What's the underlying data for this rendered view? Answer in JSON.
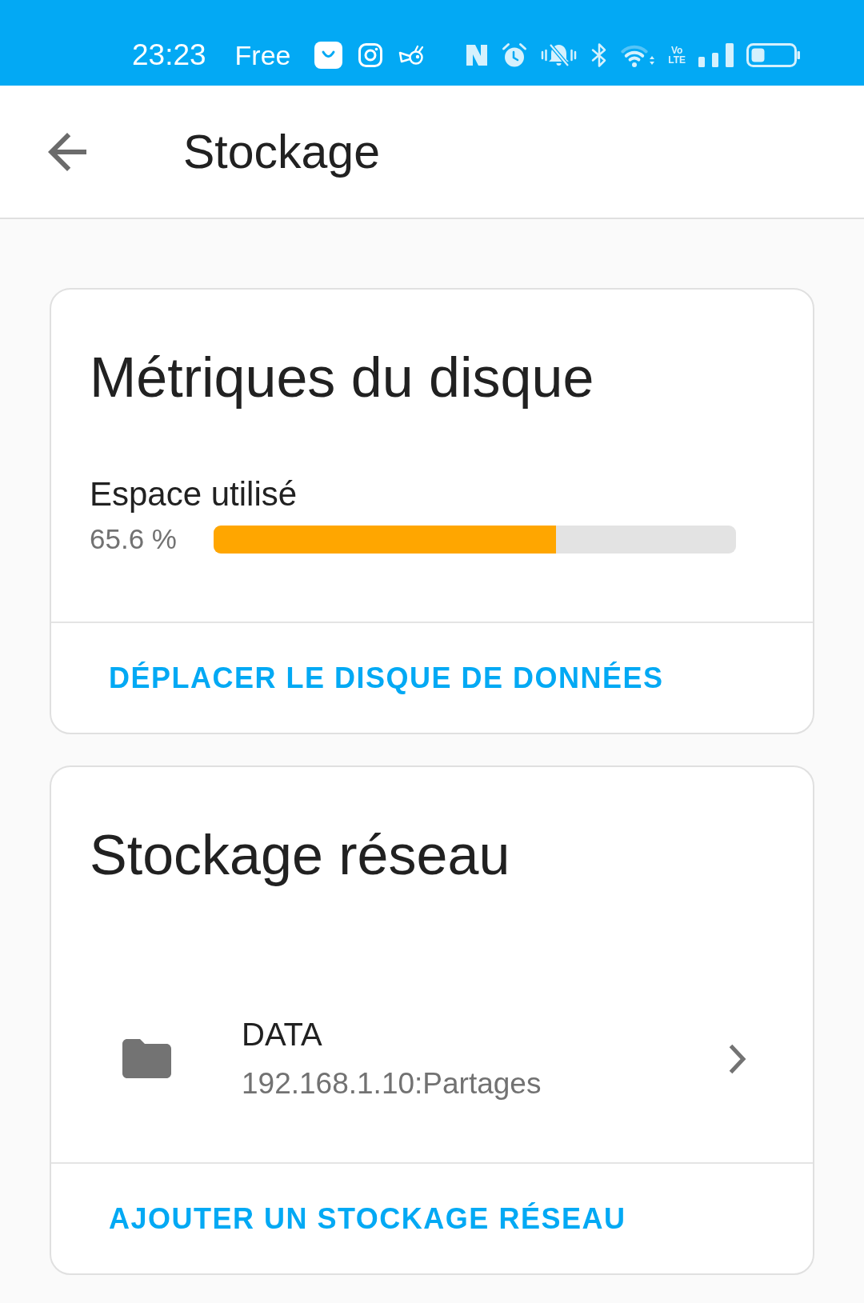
{
  "status_bar": {
    "time": "23:23",
    "carrier": "Free",
    "network_type": [
      "Vo",
      "LTE"
    ]
  },
  "header": {
    "title": "Stockage"
  },
  "cards": [
    {
      "kind": "metrics",
      "title": "Métriques du disque",
      "metric": {
        "label": "Espace utilisé",
        "reading": "65.6 %",
        "level": 0.656
      },
      "action": "DÉPLACER LE DISQUE DE DONNÉES"
    },
    {
      "kind": "network",
      "title": "Stockage réseau",
      "items": [
        {
          "name": "DATA",
          "path": "192.168.1.10:Partages"
        }
      ],
      "action": "AJOUTER UN STOCKAGE RÉSEAU"
    }
  ]
}
